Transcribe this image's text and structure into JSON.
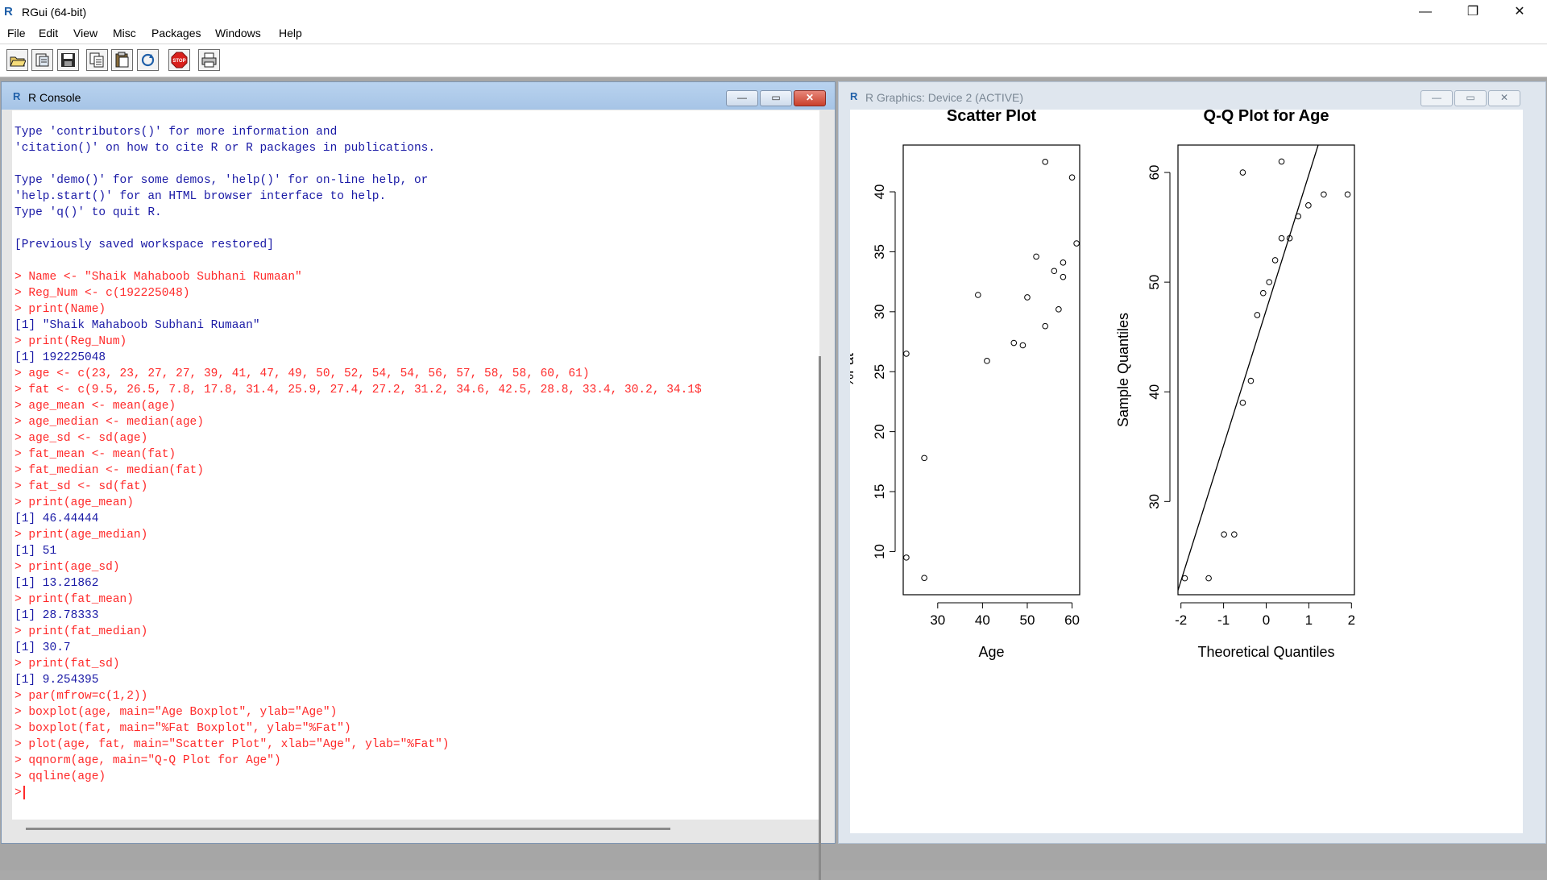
{
  "app": {
    "title": "RGui (64-bit)",
    "icon": "R"
  },
  "window_controls": {
    "minimize": "—",
    "restore": "❐",
    "close": "✕"
  },
  "menu": [
    "File",
    "Edit",
    "View",
    "Misc",
    "Packages",
    "Windows",
    "Help"
  ],
  "toolbar": [
    {
      "name": "open-script-button",
      "icon": "open-folder-icon"
    },
    {
      "name": "load-workspace-button",
      "icon": "load-workspace-icon"
    },
    {
      "name": "save-workspace-button",
      "icon": "save-icon"
    },
    {
      "name": "copy-button",
      "icon": "copy-icon"
    },
    {
      "name": "paste-button",
      "icon": "paste-icon"
    },
    {
      "name": "copy-paste-button",
      "icon": "refresh-icon"
    },
    {
      "name": "stop-button",
      "icon": "stop-icon",
      "label": "STOP"
    },
    {
      "name": "print-button",
      "icon": "print-icon"
    }
  ],
  "console": {
    "title": "R Console",
    "icon": "R",
    "lines": [
      {
        "type": "info",
        "text": "Type 'contributors()' for more information and"
      },
      {
        "type": "info",
        "text": "'citation()' on how to cite R or R packages in publications."
      },
      {
        "type": "blank",
        "text": ""
      },
      {
        "type": "info",
        "text": "Type 'demo()' for some demos, 'help()' for on-line help, or"
      },
      {
        "type": "info",
        "text": "'help.start()' for an HTML browser interface to help."
      },
      {
        "type": "info",
        "text": "Type 'q()' to quit R."
      },
      {
        "type": "blank",
        "text": ""
      },
      {
        "type": "info",
        "text": "[Previously saved workspace restored]"
      },
      {
        "type": "blank",
        "text": ""
      },
      {
        "type": "cmd",
        "text": "> Name <- \"Shaik Mahaboob Subhani Rumaan\""
      },
      {
        "type": "cmd",
        "text": "> Reg_Num <- c(192225048)"
      },
      {
        "type": "cmd",
        "text": "> print(Name)"
      },
      {
        "type": "out",
        "text": "[1] \"Shaik Mahaboob Subhani Rumaan\""
      },
      {
        "type": "cmd",
        "text": "> print(Reg_Num)"
      },
      {
        "type": "out",
        "text": "[1] 192225048"
      },
      {
        "type": "cmd",
        "text": "> age <- c(23, 23, 27, 27, 39, 41, 47, 49, 50, 52, 54, 54, 56, 57, 58, 58, 60, 61)"
      },
      {
        "type": "cmd",
        "text": "> fat <- c(9.5, 26.5, 7.8, 17.8, 31.4, 25.9, 27.4, 27.2, 31.2, 34.6, 42.5, 28.8, 33.4, 30.2, 34.1$"
      },
      {
        "type": "cmd",
        "text": "> age_mean <- mean(age)"
      },
      {
        "type": "cmd",
        "text": "> age_median <- median(age)"
      },
      {
        "type": "cmd",
        "text": "> age_sd <- sd(age)"
      },
      {
        "type": "cmd",
        "text": "> fat_mean <- mean(fat)"
      },
      {
        "type": "cmd",
        "text": "> fat_median <- median(fat)"
      },
      {
        "type": "cmd",
        "text": "> fat_sd <- sd(fat)"
      },
      {
        "type": "cmd",
        "text": "> print(age_mean)"
      },
      {
        "type": "out",
        "text": "[1] 46.44444"
      },
      {
        "type": "cmd",
        "text": "> print(age_median)"
      },
      {
        "type": "out",
        "text": "[1] 51"
      },
      {
        "type": "cmd",
        "text": "> print(age_sd)"
      },
      {
        "type": "out",
        "text": "[1] 13.21862"
      },
      {
        "type": "cmd",
        "text": "> print(fat_mean)"
      },
      {
        "type": "out",
        "text": "[1] 28.78333"
      },
      {
        "type": "cmd",
        "text": "> print(fat_median)"
      },
      {
        "type": "out",
        "text": "[1] 30.7"
      },
      {
        "type": "cmd",
        "text": "> print(fat_sd)"
      },
      {
        "type": "out",
        "text": "[1] 9.254395"
      },
      {
        "type": "cmd",
        "text": "> par(mfrow=c(1,2))"
      },
      {
        "type": "cmd",
        "text": "> boxplot(age, main=\"Age Boxplot\", ylab=\"Age\")"
      },
      {
        "type": "cmd",
        "text": "> boxplot(fat, main=\"%Fat Boxplot\", ylab=\"%Fat\")"
      },
      {
        "type": "cmd",
        "text": "> plot(age, fat, main=\"Scatter Plot\", xlab=\"Age\", ylab=\"%Fat\")"
      },
      {
        "type": "cmd",
        "text": "> qqnorm(age, main=\"Q-Q Plot for Age\")"
      },
      {
        "type": "cmd",
        "text": "> qqline(age)"
      }
    ],
    "prompt": ">"
  },
  "graphics": {
    "title": "R Graphics: Device 2 (ACTIVE)",
    "icon": "R"
  },
  "chart_data": [
    {
      "type": "scatter",
      "title": "Scatter Plot",
      "xlabel": "Age",
      "ylabel": "%Fat",
      "xlim": [
        22.3,
        61.7
      ],
      "ylim": [
        6.4,
        43.9
      ],
      "xticks": [
        30,
        40,
        50,
        60
      ],
      "yticks": [
        10,
        15,
        20,
        25,
        30,
        35,
        40
      ],
      "x": [
        23,
        23,
        27,
        27,
        39,
        41,
        47,
        49,
        50,
        52,
        54,
        54,
        56,
        57,
        58,
        58,
        60,
        61
      ],
      "y": [
        9.5,
        26.5,
        7.8,
        17.8,
        31.4,
        25.9,
        27.4,
        27.2,
        31.2,
        34.6,
        42.5,
        28.8,
        33.4,
        30.2,
        34.1,
        32.9,
        41.2,
        35.7
      ]
    },
    {
      "type": "scatter",
      "title": "Q-Q Plot for Age",
      "xlabel": "Theoretical Quantiles",
      "ylabel": "Sample Quantiles",
      "xlim": [
        -2.07,
        2.07
      ],
      "ylim": [
        21.5,
        62.5
      ],
      "xticks": [
        -2,
        -1,
        0,
        1,
        2
      ],
      "yticks": [
        30,
        40,
        50,
        60
      ],
      "x": [
        -1.91,
        -1.35,
        -0.99,
        -0.75,
        -0.55,
        -0.36,
        -0.21,
        -0.07,
        0.07,
        0.21,
        0.36,
        0.55,
        0.75,
        0.99,
        1.35,
        1.91,
        -0.55,
        0.36
      ],
      "y": [
        23,
        23,
        27,
        27,
        39,
        41,
        47,
        49,
        50,
        52,
        54,
        54,
        56,
        57,
        58,
        58,
        60,
        61
      ],
      "qqline": {
        "x": [
          -2.07,
          2.07
        ],
        "y": [
          21.9,
          73.0
        ]
      }
    }
  ]
}
